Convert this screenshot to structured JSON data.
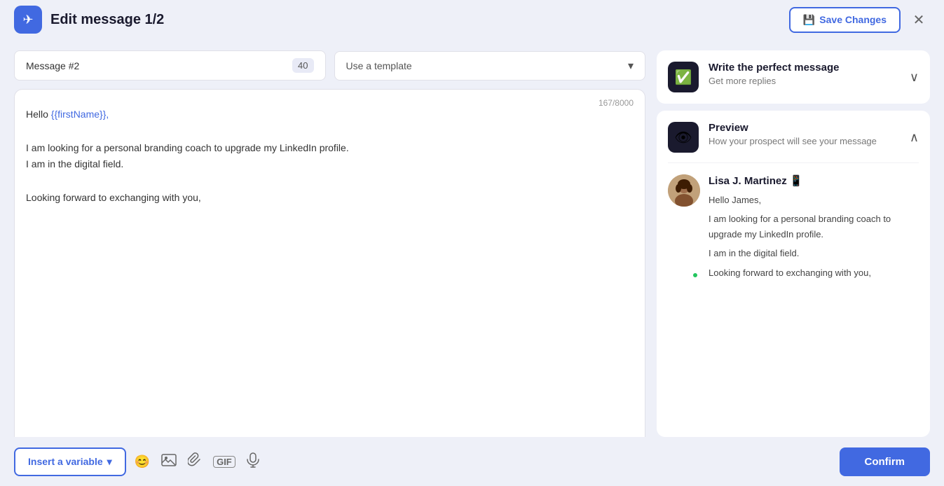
{
  "header": {
    "title": "Edit message 1/2",
    "logo_icon": "✈",
    "save_changes_label": "Save Changes",
    "close_icon": "✕"
  },
  "controls": {
    "message_label": "Message #2",
    "char_count": "40",
    "template_placeholder": "Use a template",
    "template_chevron": "▾"
  },
  "editor": {
    "char_limit": "167/8000",
    "greeting": "Hello ",
    "variable": "{{firstName}},",
    "line1": "I am looking for a personal branding coach to upgrade my LinkedIn profile.",
    "line2": "I am in the digital field.",
    "line3": "Looking forward to exchanging with you,"
  },
  "toolbar": {
    "insert_variable_label": "Insert a variable",
    "insert_chevron": "▾",
    "emoji_icon": "😊",
    "image_icon": "🖼",
    "attachment_icon": "📎",
    "gif_icon": "GIF",
    "mic_icon": "🎤",
    "confirm_label": "Confirm"
  },
  "right_panel": {
    "tips_card": {
      "icon": "✅",
      "title": "Write the perfect message",
      "subtitle": "Get more replies",
      "collapse_icon": "∨"
    },
    "preview_card": {
      "icon": "👁",
      "title": "Preview",
      "subtitle": "How your prospect will see your message",
      "expand_icon": "∧"
    },
    "prospect": {
      "name": "Lisa J. Martinez 📱",
      "greeting": "Hello James,",
      "line1": "I am looking for a personal branding coach to upgrade my LinkedIn profile.",
      "line2": "I am in the digital field.",
      "line3": "Looking forward to exchanging with you,"
    }
  }
}
